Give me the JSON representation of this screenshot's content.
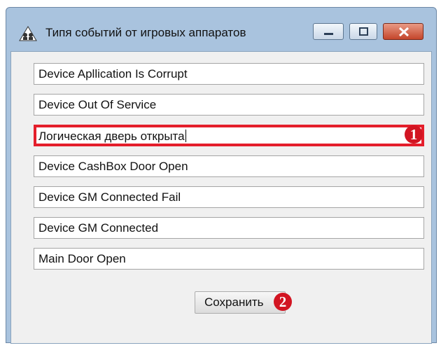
{
  "window": {
    "title": "Типя событий от игровых аппаратов",
    "icon": "users-icon",
    "controls": {
      "minimize": "minimize-icon",
      "maximize": "maximize-icon",
      "close": "close-icon"
    }
  },
  "fields": [
    {
      "value": "Device Apllication Is Corrupt"
    },
    {
      "value": "Device Out Of Service"
    },
    {
      "value": "Логическая дверь открыта"
    },
    {
      "value": "Device CashBox Door Open"
    },
    {
      "value": "Device GM Connected Fail"
    },
    {
      "value": "Device GM Connected"
    },
    {
      "value": "Main Door Open"
    }
  ],
  "save_button": {
    "label": "Сохранить"
  },
  "annotations": {
    "badge1": "1",
    "badge2": "2"
  },
  "colors": {
    "highlight": "#e41e2b",
    "badge": "#d21522",
    "window_frame": "#a9c3de"
  }
}
